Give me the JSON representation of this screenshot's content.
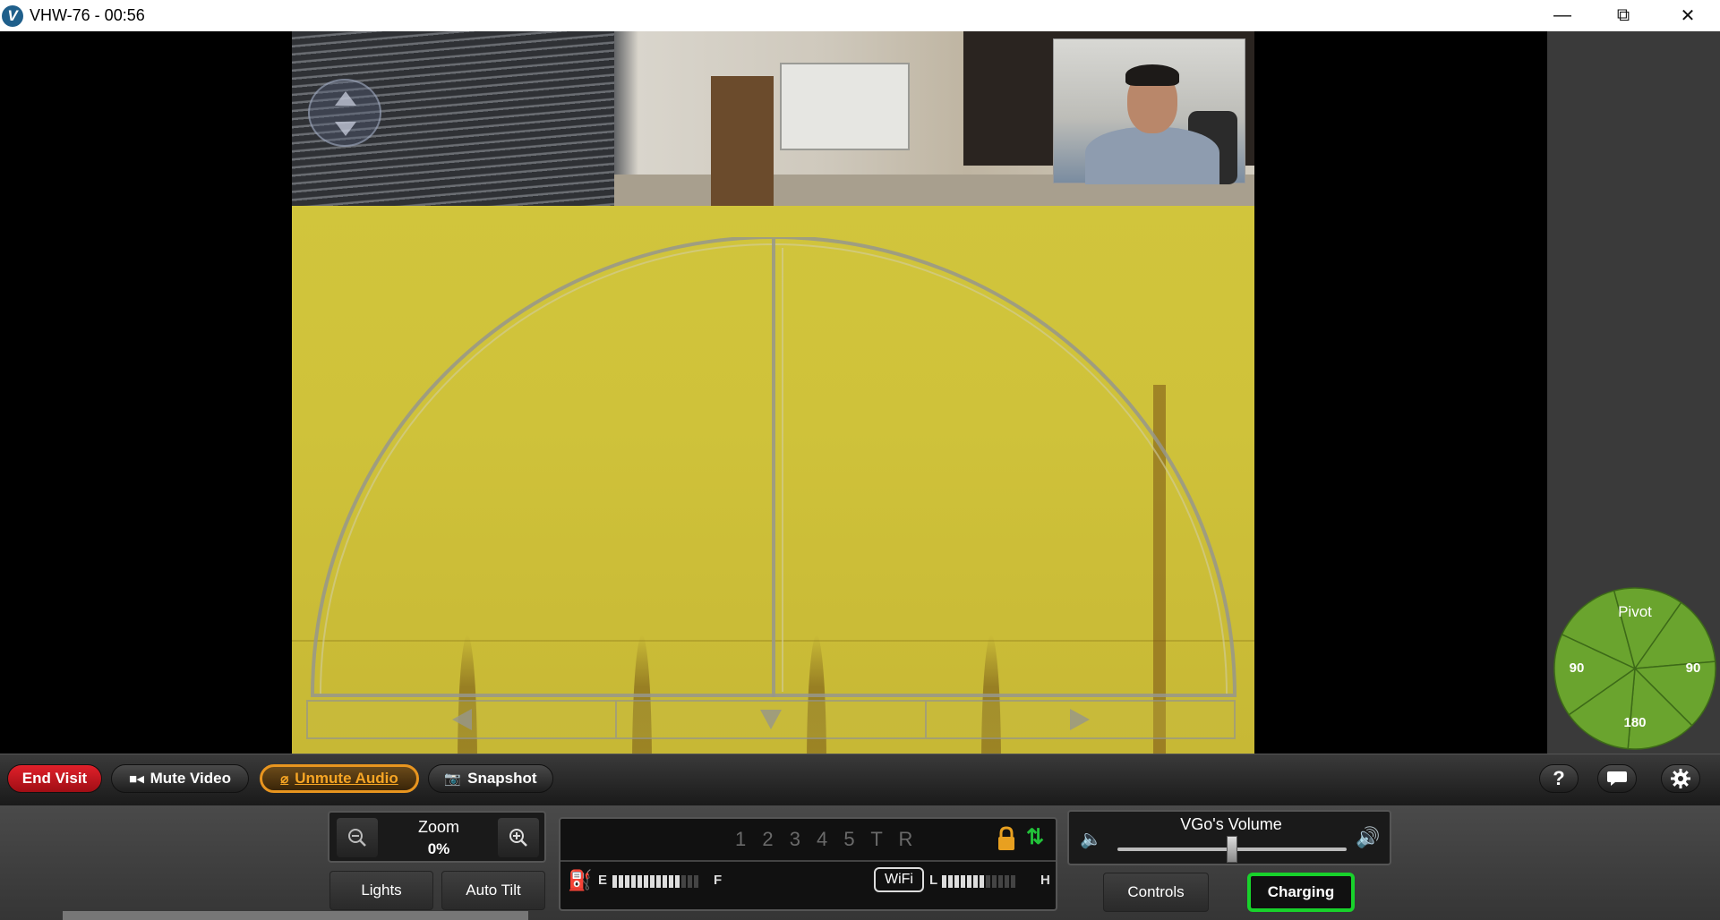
{
  "window": {
    "title": "VHW-76 - 00:56",
    "logo_letter": "V",
    "minimize_glyph": "—",
    "maximize_glyph": "⧉",
    "close_glyph": "✕"
  },
  "toolbar": {
    "end_visit_label": "End Visit",
    "mute_video_label": "Mute Video",
    "unmute_audio_label": "Unmute Audio",
    "snapshot_label": "Snapshot",
    "help_glyph": "?",
    "end_visit_color": "#d4151e",
    "unmute_accent": "#e8951f"
  },
  "zoom": {
    "label": "Zoom",
    "value": "0%"
  },
  "buttons": {
    "lights_label": "Lights",
    "auto_tilt_label": "Auto Tilt",
    "controls_label": "Controls",
    "charging_label": "Charging",
    "charging_color": "#18d22b"
  },
  "status": {
    "gears": "1 2 3 4 5 T R",
    "battery_empty": "E",
    "battery_full": "F",
    "battery_level": 0.8,
    "wifi_label": "WiFi",
    "wifi_low": "L",
    "wifi_high": "H",
    "wifi_level": 0.6
  },
  "volume": {
    "label": "VGo's Volume",
    "level": 0.5
  },
  "pivot": {
    "label": "Pivot",
    "left": "90",
    "right": "90",
    "back": "180",
    "color": "#6aa42e"
  },
  "icons": {
    "tilt": "tilt-control-icon",
    "drive": "drive-arc-icon",
    "lock": "lock-icon",
    "arrows": "up-down-arrows-icon",
    "fuel": "fuel-icon",
    "chat": "chat-icon",
    "settings": "gear-icon",
    "camera": "camera-icon",
    "video": "video-camera-icon"
  }
}
